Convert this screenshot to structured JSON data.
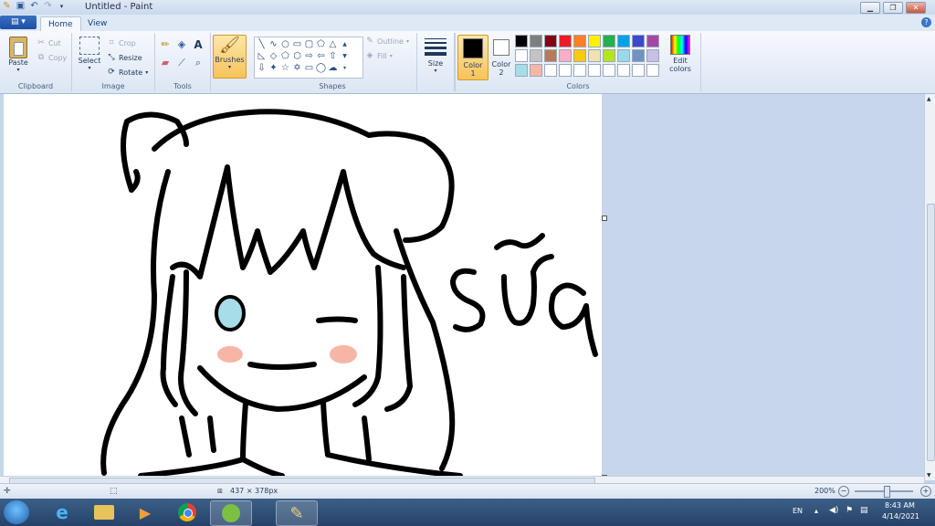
{
  "window": {
    "title": "Untitled - Paint"
  },
  "tabs": {
    "file_label": "▤ ▾",
    "home": "Home",
    "view": "View"
  },
  "clipboard": {
    "label": "Clipboard",
    "paste": "Paste",
    "cut": "Cut",
    "copy": "Copy"
  },
  "image": {
    "label": "Image",
    "select": "Select",
    "crop": "Crop",
    "resize": "Resize",
    "rotate": "Rotate"
  },
  "tools": {
    "label": "Tools"
  },
  "brushes": {
    "label": "Brushes"
  },
  "shapes": {
    "label": "Shapes",
    "outline": "Outline",
    "fill": "Fill"
  },
  "size": {
    "label": "Size"
  },
  "colors": {
    "label": "Colors",
    "color1_label": "Color",
    "color1_num": "1",
    "color2_label": "Color",
    "color2_num": "2",
    "edit_label": "Edit",
    "edit_label2": "colors",
    "color1": "#000000",
    "color2": "#ffffff",
    "palette": [
      "#000000",
      "#7f7f7f",
      "#880015",
      "#ed1c24",
      "#ff7f27",
      "#fff200",
      "#22b14c",
      "#00a2e8",
      "#3f48cc",
      "#a349a4",
      "#ffffff",
      "#c3c3c3",
      "#b97a57",
      "#ffaec9",
      "#ffc90e",
      "#efe4b0",
      "#b5e61d",
      "#99d9ea",
      "#7092be",
      "#c8bfe7",
      "#a6dde8",
      "#f7b6a5",
      "#ffffff",
      "#ffffff",
      "#ffffff",
      "#ffffff",
      "#ffffff",
      "#ffffff",
      "#ffffff",
      "#ffffff"
    ]
  },
  "status": {
    "dimensions": "437 × 378px",
    "zoom": "200%"
  },
  "taskbar": {
    "lang": "EN",
    "time": "8:43 AM",
    "date": "4/14/2021"
  }
}
